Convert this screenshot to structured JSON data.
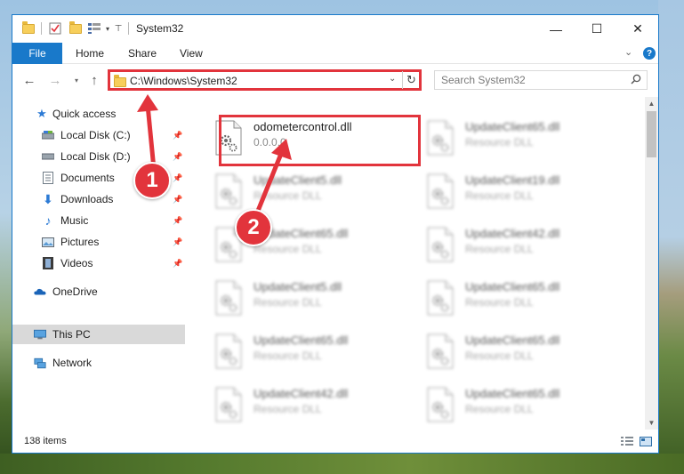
{
  "window": {
    "title": "System32",
    "minimize_glyph": "—",
    "maximize_glyph": "☐",
    "close_glyph": "✕"
  },
  "ribbon": {
    "tabs": [
      "File",
      "Home",
      "Share",
      "View"
    ],
    "help_glyph": "?",
    "expand_glyph": "⌄"
  },
  "address": {
    "path": "C:\\Windows\\System32",
    "search_placeholder": "Search System32"
  },
  "nav": {
    "items": [
      {
        "label": "Quick access",
        "icon": "star-icon"
      },
      {
        "label": "Local Disk (C:)",
        "icon": "drive-icon",
        "pinned": true
      },
      {
        "label": "Local Disk (D:)",
        "icon": "drive-icon",
        "pinned": true
      },
      {
        "label": "Documents",
        "icon": "documents-icon",
        "pinned": true
      },
      {
        "label": "Downloads",
        "icon": "download-icon",
        "pinned": true
      },
      {
        "label": "Music",
        "icon": "music-icon",
        "pinned": true
      },
      {
        "label": "Pictures",
        "icon": "pictures-icon",
        "pinned": true
      },
      {
        "label": "Videos",
        "icon": "videos-icon",
        "pinned": true
      },
      {
        "label": "OneDrive",
        "icon": "cloud-icon"
      },
      {
        "label": "This PC",
        "icon": "computer-icon",
        "selected": true
      },
      {
        "label": "Network",
        "icon": "network-icon"
      }
    ]
  },
  "files": {
    "highlighted": {
      "name": "odometercontrol.dll",
      "sub": "0.0.0.0"
    },
    "left_column": [
      {
        "name": "UpdateClient5.dll",
        "sub": "Resource DLL"
      },
      {
        "name": "UpdateClient65.dll",
        "sub": "Resource DLL"
      },
      {
        "name": "UpdateClient5.dll",
        "sub": "Resource DLL"
      },
      {
        "name": "UpdateClient65.dll",
        "sub": "Resource DLL"
      },
      {
        "name": "UpdateClient42.dll",
        "sub": "Resource DLL"
      }
    ],
    "right_column": [
      {
        "name": "UpdateClient65.dll",
        "sub": "Resource DLL"
      },
      {
        "name": "UpdateClient19.dll",
        "sub": "Resource DLL"
      },
      {
        "name": "UpdateClient42.dll",
        "sub": "Resource DLL"
      },
      {
        "name": "UpdateClient65.dll",
        "sub": "Resource DLL"
      },
      {
        "name": "UpdateClient65.dll",
        "sub": "Resource DLL"
      },
      {
        "name": "UpdateClient65.dll",
        "sub": "Resource DLL"
      }
    ]
  },
  "status": {
    "item_count": "138 items"
  },
  "annotations": {
    "step1": "1",
    "step2": "2",
    "color": "#e2343c"
  },
  "colors": {
    "accent": "#1979ca",
    "highlight": "#e2343c"
  }
}
